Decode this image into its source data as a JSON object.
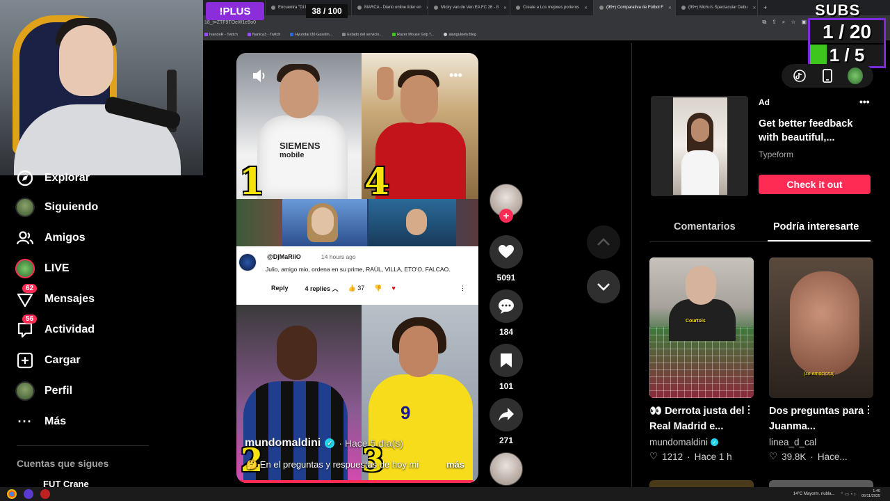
{
  "browser": {
    "tabs": [
      {
        "label": "d"
      },
      {
        "label": "Encuentra \"DI MARIA\" EQUIPO"
      },
      {
        "label": "MARCA - Diario online líder en"
      },
      {
        "label": "Micky van de Ven EA FC 26 - 8"
      },
      {
        "label": "Create a Los mejores porteros"
      },
      {
        "label": "(99+) Comparativa de Fútbol F"
      },
      {
        "label": "(99+) Michu's Spectacular Debu"
      }
    ],
    "url": "18_t=ZTF9TOeW1e9o0",
    "bookmarks": [
      "IvandeR - Twitch",
      "Nanica3 - Twitch",
      "Hyundai i30 Gasolin...",
      "Estado del servicio...",
      "Razer Mouse Grip T...",
      "alanguloetv.blog"
    ]
  },
  "overlay": {
    "plus": "!PLUS",
    "counter": "38 / 100",
    "subs_title": "SUBS HOY",
    "subs_row1": "1 / 20",
    "subs_row2": "1 / 5",
    "subs_row2_progress": 0.23,
    "plus_color": "#8c2ddc",
    "subs_fill_color": "#3ec61e"
  },
  "sidebar": {
    "items": [
      {
        "label": "Explorar",
        "icon": "compass-icon"
      },
      {
        "label": "Siguiendo",
        "icon": "following-avatar-icon"
      },
      {
        "label": "Amigos",
        "icon": "friends-icon"
      },
      {
        "label": "LIVE",
        "icon": "live-icon"
      },
      {
        "label": "Mensajes",
        "icon": "messages-icon",
        "badge": "62"
      },
      {
        "label": "Actividad",
        "icon": "activity-icon",
        "badge": "56"
      },
      {
        "label": "Cargar",
        "icon": "upload-icon"
      },
      {
        "label": "Perfil",
        "icon": "profile-avatar-icon"
      },
      {
        "label": "Más",
        "icon": "more-icon"
      }
    ],
    "following_heading": "Cuentas que sigues",
    "following_first": "FUT Crane"
  },
  "video": {
    "number_1": "1",
    "number_2": "4",
    "number_3": "2",
    "number_4": "3",
    "sponsor_line1": "SIEMENS",
    "sponsor_line2": "mobile",
    "jersey_number": "9",
    "embedded_comment": {
      "user": "@DjMaRiiO",
      "time": "14 hours ago",
      "text": "Julio, amigo mio, ordena en su prime, RAÚL, VILLA, ETO'O, FALCAO.",
      "reply": "Reply",
      "replies": "4 replies",
      "likes": "37"
    },
    "author": "mundomaldini",
    "date": "· Hace 5 día(s)",
    "description": "🤔 En el preguntas y respuestas de hoy mi",
    "more": "más",
    "progress": 0.98,
    "accent": "#fe2c55"
  },
  "actions": {
    "likes": "5091",
    "comments": "184",
    "saves": "101",
    "shares": "271"
  },
  "right": {
    "ad": {
      "label": "Ad",
      "title": "Get better feedback with beautiful,...",
      "brand": "Typeform",
      "cta": "Check it out"
    },
    "tabs": {
      "comments": "Comentarios",
      "suggested": "Podría interesarte"
    },
    "recs": [
      {
        "caption": "Courtois",
        "title": "👀 Derrota justa del Real Madrid e...",
        "author": "mundomaldini",
        "likes": "1212",
        "time": "Hace 1 h"
      },
      {
        "caption": "(se emociona)",
        "title": "Dos preguntas para Juanma...",
        "author": "linea_d_cal",
        "likes": "39.8K",
        "time": "Hace..."
      }
    ]
  },
  "taskbar": {
    "weather": "14°C  Mayorm. nubla...",
    "time": "1:40",
    "date": "05/11/2025"
  }
}
